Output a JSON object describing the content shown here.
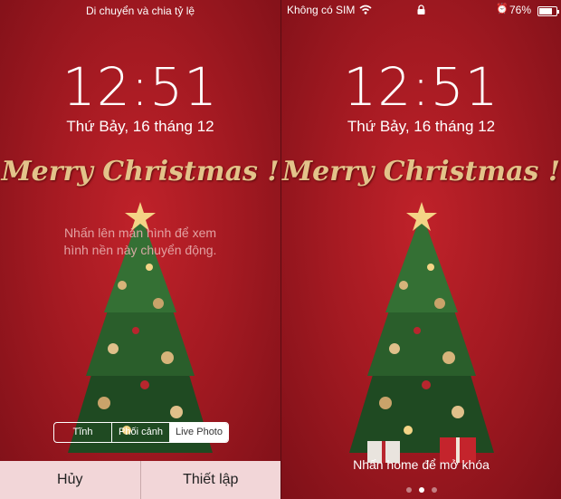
{
  "left_screen": {
    "top_label": "Di chuyển và chia tỷ lệ",
    "time": "12:51",
    "date": "Thứ Bảy, 16 tháng 12",
    "greeting": "Merry Christmas !",
    "hint_line1": "Nhấn lên màn hình để xem",
    "hint_line2": "hình nền này chuyển động.",
    "segments": [
      "Tĩnh",
      "Phối cảnh",
      "Live Photo"
    ],
    "selected_segment": "Live Photo",
    "cancel_label": "Hủy",
    "set_label": "Thiết lập"
  },
  "right_screen": {
    "carrier": "Không có SIM",
    "battery_percent": "76%",
    "battery_level": 0.76,
    "time": "12:51",
    "date": "Thứ Bảy, 16 tháng 12",
    "greeting": "Merry Christmas !",
    "unlock_hint": "Nhấn home để mở khóa",
    "page_count": 3,
    "active_page": 2
  },
  "colors": {
    "background_red": "#a51a22",
    "greeting_gold": "#e3c38a",
    "bottom_bar": "#f2d6d8"
  },
  "icons": {
    "wifi": "wifi-icon",
    "lock": "lock-icon",
    "alarm": "alarm-clock-icon",
    "battery": "battery-icon",
    "tree": "christmas-tree-image"
  }
}
